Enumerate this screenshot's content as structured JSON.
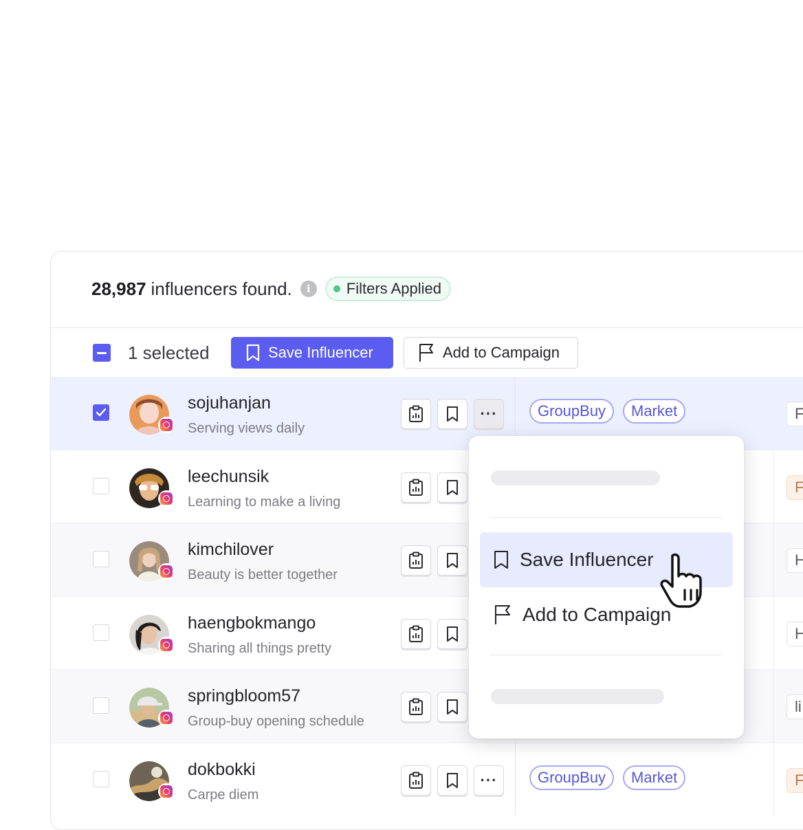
{
  "summary": {
    "count": "28,987",
    "label": "influencers found.",
    "info_glyph": "i",
    "filters_chip": "Filters Applied"
  },
  "toolbar": {
    "selected_text": "1 selected",
    "save_label": "Save Influencer",
    "campaign_label": "Add to Campaign"
  },
  "colors": {
    "accent": "#5b5cf0",
    "selected_row": "#edf0fe",
    "tag_border": "#a6a8f6",
    "filters_dot": "#52c389"
  },
  "rows": [
    {
      "name": "sojuhanjan",
      "bio": "Serving views daily",
      "checked": true,
      "tags": [
        "GroupBuy",
        "Market"
      ],
      "edge": "F"
    },
    {
      "name": "leechunsik",
      "bio": "Learning to make a living",
      "checked": false,
      "edge": "F"
    },
    {
      "name": "kimchilover",
      "bio": "Beauty is better together",
      "checked": false,
      "edge": "H"
    },
    {
      "name": "haengbokmango",
      "bio": "Sharing all things pretty",
      "checked": false,
      "edge": "H"
    },
    {
      "name": "springbloom57",
      "bio": "Group-buy opening schedule",
      "checked": false,
      "edge": "li"
    },
    {
      "name": "dokbokki",
      "bio": "Carpe diem",
      "checked": false,
      "tags": [
        "GroupBuy",
        "Market"
      ],
      "edge": "F"
    }
  ],
  "more_glyph": "···",
  "menu": {
    "save_label": "Save Influencer",
    "campaign_label": "Add to Campaign"
  },
  "icons": [
    "info-icon",
    "bookmark-icon",
    "flag-icon",
    "clipboard-chart-icon",
    "more-icon",
    "check-icon",
    "instagram-icon",
    "hand-cursor-icon"
  ]
}
